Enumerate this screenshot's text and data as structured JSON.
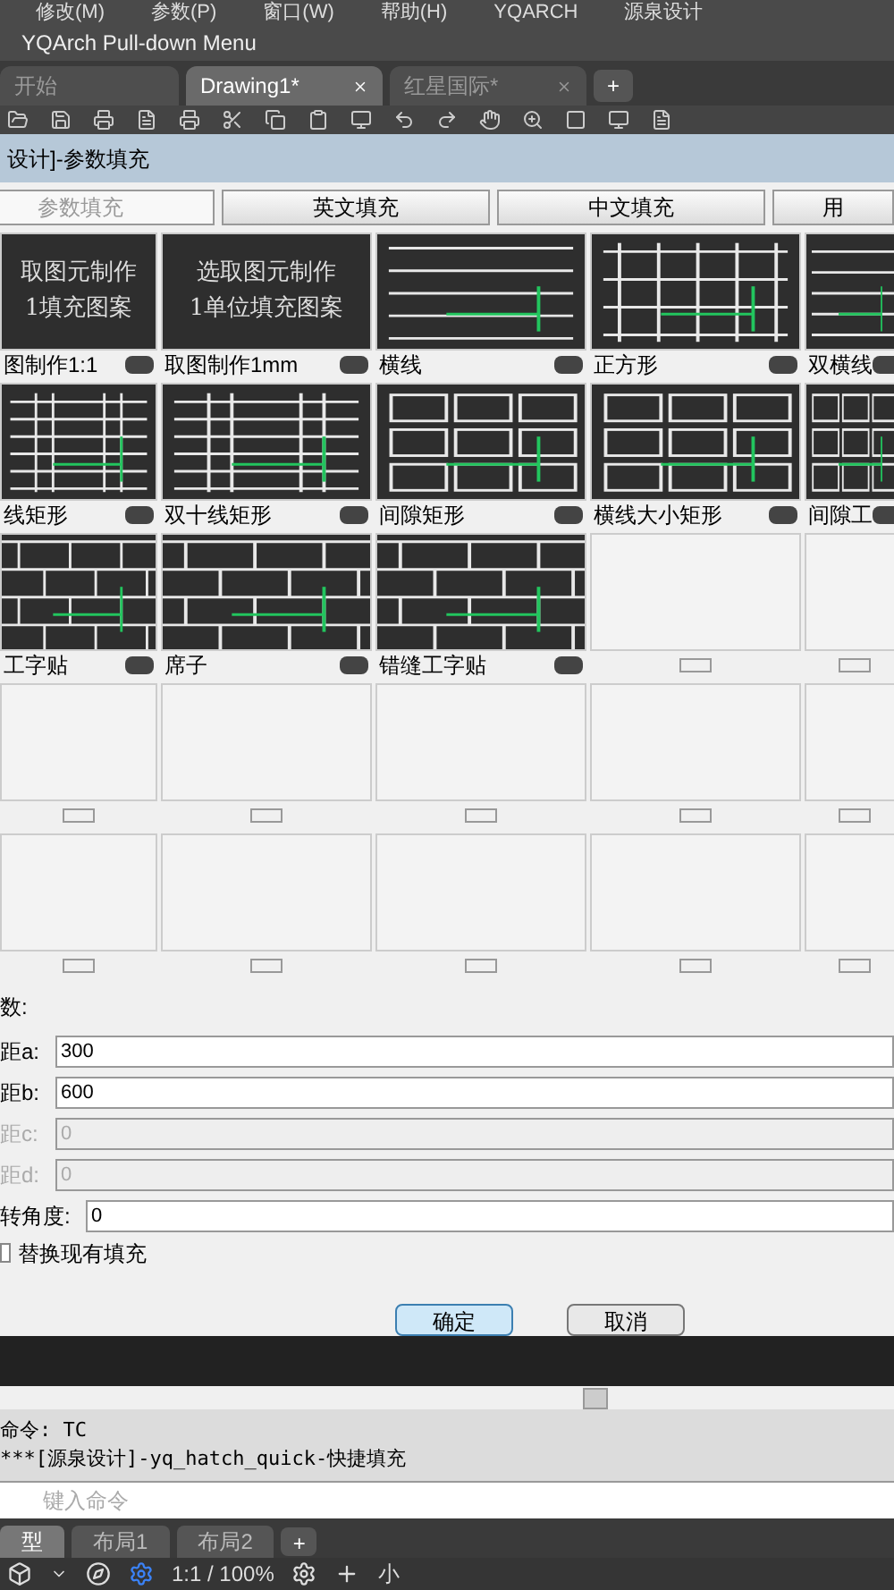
{
  "menu_bar": [
    "修改(M)",
    "参数(P)",
    "窗口(W)",
    "帮助(H)",
    "YQARCH",
    "源泉设计"
  ],
  "pulldown_title": "YQArch Pull-down Menu",
  "doc_tabs": [
    {
      "label": "开始",
      "selected": false,
      "closable": false
    },
    {
      "label": "Drawing1*",
      "selected": true,
      "closable": true
    },
    {
      "label": "红星国际*",
      "selected": false,
      "closable": true
    }
  ],
  "new_tab": "+",
  "dialog": {
    "title": "设计]-参数填充",
    "tabs": [
      {
        "label": "参数填充",
        "selected": true
      },
      {
        "label": "英文填充",
        "selected": false
      },
      {
        "label": "中文填充",
        "selected": false
      },
      {
        "label": "用",
        "selected": false
      }
    ],
    "tiles": [
      {
        "kind": "text",
        "lines": [
          "取图元制作",
          "1填充图案"
        ],
        "label": "图制作1:1"
      },
      {
        "kind": "text",
        "lines": [
          "选取图元制作",
          "1单位填充图案"
        ],
        "label": "取图制作1mm"
      },
      {
        "kind": "hlines",
        "label": "横线"
      },
      {
        "kind": "grid",
        "label": "正方形"
      },
      {
        "kind": "double-hlines",
        "label": "双横线"
      },
      {
        "kind": "cross-rect",
        "label": "线矩形"
      },
      {
        "kind": "double-cross-rect",
        "label": "双十线矩形"
      },
      {
        "kind": "gap-rect",
        "label": "间隙矩形"
      },
      {
        "kind": "size-rect",
        "label": "横线大小矩形"
      },
      {
        "kind": "gap-rect",
        "label": "间隙工"
      },
      {
        "kind": "brick",
        "label": "工字贴"
      },
      {
        "kind": "mat",
        "label": "席子"
      },
      {
        "kind": "brick",
        "label": "错缝工字贴"
      },
      {
        "kind": "empty"
      },
      {
        "kind": "empty"
      },
      {
        "kind": "empty"
      },
      {
        "kind": "empty"
      },
      {
        "kind": "empty"
      },
      {
        "kind": "empty"
      },
      {
        "kind": "empty"
      },
      {
        "kind": "empty"
      },
      {
        "kind": "empty"
      },
      {
        "kind": "empty"
      },
      {
        "kind": "empty"
      },
      {
        "kind": "empty"
      }
    ],
    "params_heading": "数:",
    "fields": [
      {
        "label": "距a:",
        "value": "300",
        "disabled": false,
        "kind": "short"
      },
      {
        "label": "距b:",
        "value": "600",
        "disabled": false,
        "kind": "short"
      },
      {
        "label": "距c:",
        "value": "0",
        "disabled": true,
        "kind": "short"
      },
      {
        "label": "距d:",
        "value": "0",
        "disabled": true,
        "kind": "short"
      },
      {
        "label": "转角度:",
        "value": "0",
        "disabled": false,
        "kind": "long"
      }
    ],
    "replace_checkbox": {
      "label": "替换现有填充",
      "checked": false
    },
    "buttons": [
      {
        "label": "确定",
        "selected": true
      },
      {
        "label": "取消",
        "selected": false
      }
    ]
  },
  "command_history": [
    "命令: TC",
    "***[源泉设计]-yq_hatch_quick-快捷填充"
  ],
  "command_input": {
    "placeholder": "键入命令"
  },
  "layout_tabs": [
    {
      "label": "型",
      "selected": true
    },
    {
      "label": "布局1",
      "selected": false
    },
    {
      "label": "布局2",
      "selected": false
    }
  ],
  "layout_new_tab": "+",
  "status_bar": {
    "scale": "1:1 / 100%",
    "cut_label": "小"
  }
}
